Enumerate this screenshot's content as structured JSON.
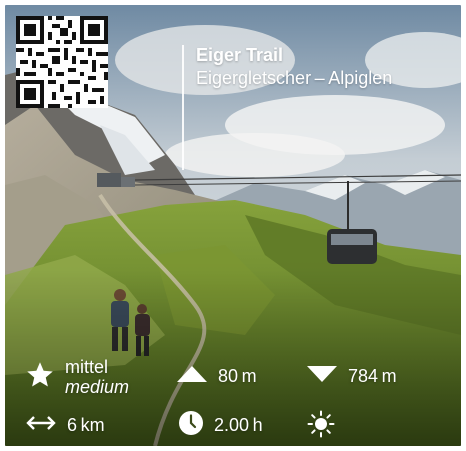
{
  "trail": {
    "name": "Eiger Trail",
    "route": "Eigergletscher – Alpiglen"
  },
  "stats": {
    "difficulty_de": "mittel",
    "difficulty_en": "medium",
    "ascent": "80 m",
    "descent": "784 m",
    "distance": "6 km",
    "duration": "2.00 h"
  },
  "icons": {
    "difficulty": "star-icon",
    "ascent": "triangle-up-icon",
    "descent": "triangle-down-icon",
    "distance": "double-arrow-icon",
    "duration": "clock-icon",
    "season": "sun-icon",
    "qr": "qr-code"
  },
  "colors": {
    "text": "#ffffff",
    "sky": "#c9d3dc",
    "meadow": "#6f8b2e"
  }
}
